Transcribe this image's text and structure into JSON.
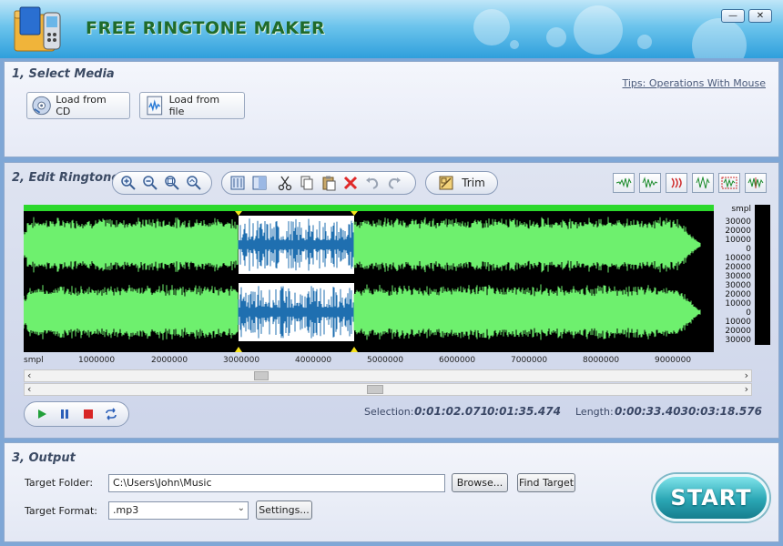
{
  "app": {
    "title": "FREE RINGTONE MAKER",
    "help_label": "?"
  },
  "window": {
    "minimize": "—",
    "close": "✕"
  },
  "media": {
    "section_title": "1, Select Media",
    "tips_link": "Tips: Operations With Mouse",
    "load_cd": "Load from CD",
    "load_file": "Load from file"
  },
  "edit": {
    "section_title": "2, Edit Ringtone",
    "trim_label": "Trim",
    "amp_unit": "smpl",
    "amp_ticks_top": [
      "30000",
      "20000",
      "10000",
      "0",
      "10000",
      "20000",
      "30000"
    ],
    "amp_ticks_bottom": [
      "30000",
      "20000",
      "10000",
      "0",
      "10000",
      "20000",
      "30000"
    ],
    "ruler_unit": "smpl",
    "ruler_ticks": [
      "1000000",
      "2000000",
      "3000000",
      "4000000",
      "5000000",
      "6000000",
      "7000000",
      "8000000",
      "9000000"
    ],
    "selection_label": "Selection:",
    "selection_start": "0:01:02.071",
    "selection_end": "0:01:35.474",
    "length_label": "Length:",
    "length_value": "0:00:33.403",
    "total_value": "0:03:18.576"
  },
  "output": {
    "section_title": "3, Output",
    "folder_label": "Target Folder:",
    "folder_value": "C:\\Users\\John\\Music",
    "browse": "Browse...",
    "find_target": "Find Target",
    "format_label": "Target Format:",
    "format_value": ".mp3",
    "settings": "Settings...",
    "start": "START"
  },
  "colors": {
    "wave_green": "#6ef06e",
    "wave_selected": "#1f6fb0",
    "selection_bg": "#ffffff",
    "start_teal": "#2aa6b4"
  }
}
